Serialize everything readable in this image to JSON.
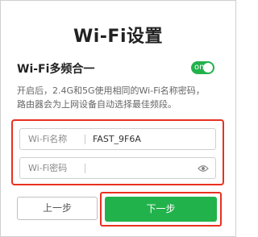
{
  "page": {
    "title": "Wi-Fi设置"
  },
  "multi_band": {
    "label": "Wi-Fi多频合一",
    "toggle_text": "on",
    "enabled": true,
    "description_lines": [
      "开启后，2.4G和5G使用相同的Wi-Fi名称密码，",
      "路由器会为上网设备自动选择最佳频段。"
    ]
  },
  "ssid_field": {
    "label": "Wi-Fi名称",
    "value": "FAST_9F6A"
  },
  "password_field": {
    "label": "Wi-Fi密码",
    "value": "",
    "icon": "eye-icon"
  },
  "buttons": {
    "prev_label": "上一步",
    "next_label": "下一步"
  },
  "colors": {
    "accent_green": "#22b24c",
    "highlight_red": "#e8311f"
  }
}
